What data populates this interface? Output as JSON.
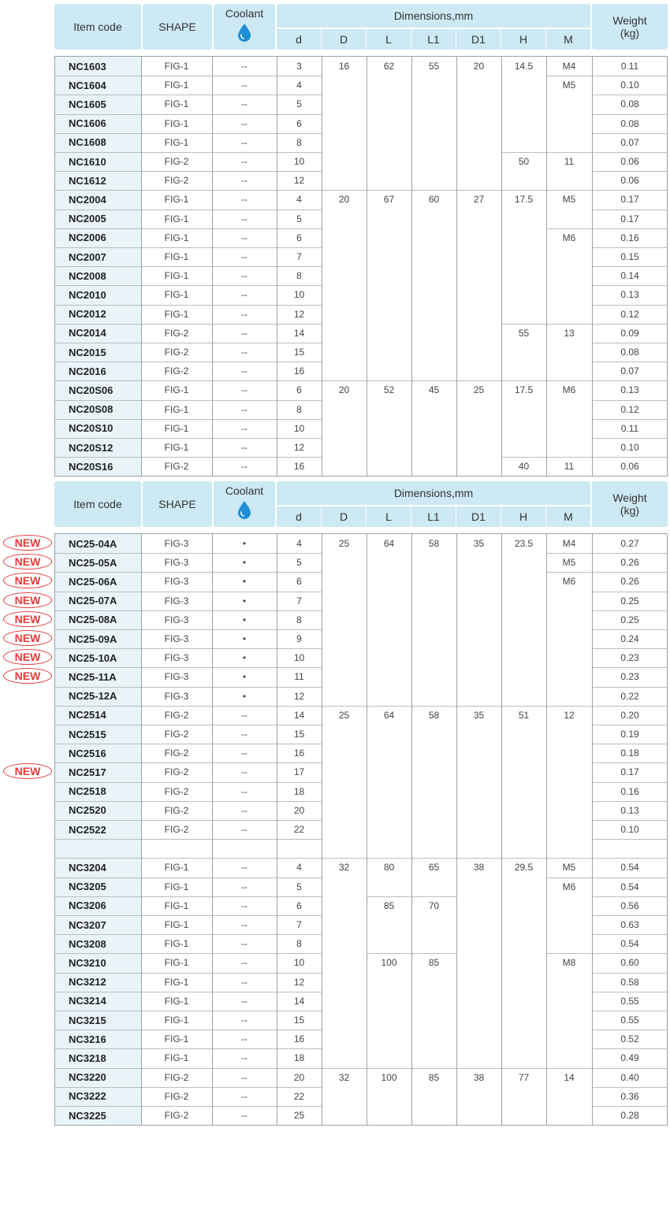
{
  "headers": {
    "item_code": "Item code",
    "shape": "SHAPE",
    "coolant": "Coolant",
    "dimensions": "Dimensions,mm",
    "dim_cols": [
      "d",
      "D",
      "L",
      "L1",
      "D1",
      "H",
      "M"
    ],
    "weight": "Weight\n(kg)"
  },
  "new_label": "NEW",
  "coolant_icon": "water-drop-icon",
  "colors": {
    "header_bg": "#cde9f3",
    "code_bg": "#e9f4f8",
    "new": "#e53a3a",
    "drop": "#1e8fd6"
  },
  "table1": [
    {
      "code": "NC1603",
      "shape": "FIG-1",
      "coolant": "--",
      "d": "3",
      "D": "16",
      "L": "62",
      "L1": "55",
      "D1": "20",
      "H": "14.5",
      "M": "M4",
      "w": "0.11"
    },
    {
      "code": "NC1604",
      "shape": "FIG-1",
      "coolant": "--",
      "d": "4",
      "D": "",
      "L": "",
      "L1": "",
      "D1": "",
      "H": "",
      "M": "M5",
      "w": "0.10"
    },
    {
      "code": "NC1605",
      "shape": "FIG-1",
      "coolant": "--",
      "d": "5",
      "D": "",
      "L": "",
      "L1": "",
      "D1": "",
      "H": "",
      "M": "",
      "w": "0.08"
    },
    {
      "code": "NC1606",
      "shape": "FIG-1",
      "coolant": "--",
      "d": "6",
      "D": "",
      "L": "",
      "L1": "",
      "D1": "",
      "H": "",
      "M": "",
      "w": "0.08"
    },
    {
      "code": "NC1608",
      "shape": "FIG-1",
      "coolant": "--",
      "d": "8",
      "D": "",
      "L": "",
      "L1": "",
      "D1": "",
      "H": "",
      "M": "",
      "w": "0.07"
    },
    {
      "code": "NC1610",
      "shape": "FIG-2",
      "coolant": "--",
      "d": "10",
      "D": "",
      "L": "",
      "L1": "",
      "D1": "",
      "H": "50",
      "M": "11",
      "w": "0.06"
    },
    {
      "code": "NC1612",
      "shape": "FIG-2",
      "coolant": "--",
      "d": "12",
      "D": "",
      "L": "",
      "L1": "",
      "D1": "",
      "H": "",
      "M": "",
      "w": "0.06"
    },
    {
      "code": "NC2004",
      "shape": "FIG-1",
      "coolant": "--",
      "d": "4",
      "D": "20",
      "L": "67",
      "L1": "60",
      "D1": "27",
      "H": "17.5",
      "M": "M5",
      "w": "0.17"
    },
    {
      "code": "NC2005",
      "shape": "FIG-1",
      "coolant": "--",
      "d": "5",
      "D": "",
      "L": "",
      "L1": "",
      "D1": "",
      "H": "",
      "M": "",
      "w": "0.17"
    },
    {
      "code": "NC2006",
      "shape": "FIG-1",
      "coolant": "--",
      "d": "6",
      "D": "",
      "L": "",
      "L1": "",
      "D1": "",
      "H": "",
      "M": "M6",
      "w": "0.16"
    },
    {
      "code": "NC2007",
      "shape": "FIG-1",
      "coolant": "--",
      "d": "7",
      "D": "",
      "L": "",
      "L1": "",
      "D1": "",
      "H": "",
      "M": "",
      "w": "0.15"
    },
    {
      "code": "NC2008",
      "shape": "FIG-1",
      "coolant": "--",
      "d": "8",
      "D": "",
      "L": "",
      "L1": "",
      "D1": "",
      "H": "",
      "M": "",
      "w": "0.14"
    },
    {
      "code": "NC2010",
      "shape": "FIG-1",
      "coolant": "--",
      "d": "10",
      "D": "",
      "L": "",
      "L1": "",
      "D1": "",
      "H": "",
      "M": "",
      "w": "0.13"
    },
    {
      "code": "NC2012",
      "shape": "FIG-1",
      "coolant": "--",
      "d": "12",
      "D": "",
      "L": "",
      "L1": "",
      "D1": "",
      "H": "",
      "M": "",
      "w": "0.12"
    },
    {
      "code": "NC2014",
      "shape": "FIG-2",
      "coolant": "--",
      "d": "14",
      "D": "",
      "L": "",
      "L1": "",
      "D1": "",
      "H": "55",
      "M": "13",
      "w": "0.09"
    },
    {
      "code": "NC2015",
      "shape": "FIG-2",
      "coolant": "--",
      "d": "15",
      "D": "",
      "L": "",
      "L1": "",
      "D1": "",
      "H": "",
      "M": "",
      "w": "0.08"
    },
    {
      "code": "NC2016",
      "shape": "FIG-2",
      "coolant": "--",
      "d": "16",
      "D": "",
      "L": "",
      "L1": "",
      "D1": "",
      "H": "",
      "M": "",
      "w": "0.07"
    },
    {
      "code": "NC20S06",
      "shape": "FIG-1",
      "coolant": "--",
      "d": "6",
      "D": "20",
      "L": "52",
      "L1": "45",
      "D1": "25",
      "H": "17.5",
      "M": "M6",
      "w": "0.13"
    },
    {
      "code": "NC20S08",
      "shape": "FIG-1",
      "coolant": "--",
      "d": "8",
      "D": "",
      "L": "",
      "L1": "",
      "D1": "",
      "H": "",
      "M": "",
      "w": "0.12"
    },
    {
      "code": "NC20S10",
      "shape": "FIG-1",
      "coolant": "--",
      "d": "10",
      "D": "",
      "L": "",
      "L1": "",
      "D1": "",
      "H": "",
      "M": "",
      "w": "0.11"
    },
    {
      "code": "NC20S12",
      "shape": "FIG-1",
      "coolant": "--",
      "d": "12",
      "D": "",
      "L": "",
      "L1": "",
      "D1": "",
      "H": "",
      "M": "",
      "w": "0.10"
    },
    {
      "code": "NC20S16",
      "shape": "FIG-2",
      "coolant": "--",
      "d": "16",
      "D": "",
      "L": "",
      "L1": "",
      "D1": "",
      "H": "40",
      "M": "11",
      "w": "0.06"
    }
  ],
  "table2": [
    {
      "code": "NC25-04A",
      "new": true,
      "shape": "FIG-3",
      "coolant": "•",
      "d": "4",
      "D": "25",
      "L": "64",
      "L1": "58",
      "D1": "35",
      "H": "23.5",
      "M": "M4",
      "w": "0.27"
    },
    {
      "code": "NC25-05A",
      "new": true,
      "shape": "FIG-3",
      "coolant": "•",
      "d": "5",
      "D": "",
      "L": "",
      "L1": "",
      "D1": "",
      "H": "",
      "M": "M5",
      "w": "0.26"
    },
    {
      "code": "NC25-06A",
      "new": true,
      "shape": "FIG-3",
      "coolant": "•",
      "d": "6",
      "D": "",
      "L": "",
      "L1": "",
      "D1": "",
      "H": "",
      "M": "M6",
      "w": "0.26"
    },
    {
      "code": "NC25-07A",
      "new": true,
      "shape": "FIG-3",
      "coolant": "•",
      "d": "7",
      "D": "",
      "L": "",
      "L1": "",
      "D1": "",
      "H": "",
      "M": "",
      "w": "0.25"
    },
    {
      "code": "NC25-08A",
      "new": true,
      "shape": "FIG-3",
      "coolant": "•",
      "d": "8",
      "D": "",
      "L": "",
      "L1": "",
      "D1": "",
      "H": "",
      "M": "",
      "w": "0.25"
    },
    {
      "code": "NC25-09A",
      "new": true,
      "shape": "FIG-3",
      "coolant": "•",
      "d": "9",
      "D": "",
      "L": "",
      "L1": "",
      "D1": "",
      "H": "",
      "M": "",
      "w": "0.24"
    },
    {
      "code": "NC25-10A",
      "new": true,
      "shape": "FIG-3",
      "coolant": "•",
      "d": "10",
      "D": "",
      "L": "",
      "L1": "",
      "D1": "",
      "H": "",
      "M": "",
      "w": "0.23"
    },
    {
      "code": "NC25-11A",
      "new": true,
      "shape": "FIG-3",
      "coolant": "•",
      "d": "11",
      "D": "",
      "L": "",
      "L1": "",
      "D1": "",
      "H": "",
      "M": "",
      "w": "0.23"
    },
    {
      "code": "NC25-12A",
      "new": false,
      "shape": "FIG-3",
      "coolant": "•",
      "d": "12",
      "D": "",
      "L": "",
      "L1": "",
      "D1": "",
      "H": "",
      "M": "",
      "w": "0.22"
    },
    {
      "code": "NC2514",
      "new": false,
      "shape": "FIG-2",
      "coolant": "--",
      "d": "14",
      "D": "25",
      "L": "64",
      "L1": "58",
      "D1": "35",
      "H": "51",
      "M": "12",
      "w": "0.20"
    },
    {
      "code": "NC2515",
      "new": false,
      "shape": "FIG-2",
      "coolant": "--",
      "d": "15",
      "D": "",
      "L": "",
      "L1": "",
      "D1": "",
      "H": "",
      "M": "",
      "w": "0.19"
    },
    {
      "code": "NC2516",
      "new": false,
      "shape": "FIG-2",
      "coolant": "--",
      "d": "16",
      "D": "",
      "L": "",
      "L1": "",
      "D1": "",
      "H": "",
      "M": "",
      "w": "0.18"
    },
    {
      "code": "NC2517",
      "new": true,
      "shape": "FIG-2",
      "coolant": "--",
      "d": "17",
      "D": "",
      "L": "",
      "L1": "",
      "D1": "",
      "H": "",
      "M": "",
      "w": "0.17"
    },
    {
      "code": "NC2518",
      "new": false,
      "shape": "FIG-2",
      "coolant": "--",
      "d": "18",
      "D": "",
      "L": "",
      "L1": "",
      "D1": "",
      "H": "",
      "M": "",
      "w": "0.16"
    },
    {
      "code": "NC2520",
      "new": false,
      "shape": "FIG-2",
      "coolant": "--",
      "d": "20",
      "D": "",
      "L": "",
      "L1": "",
      "D1": "",
      "H": "",
      "M": "",
      "w": "0.13"
    },
    {
      "code": "NC2522",
      "new": false,
      "shape": "FIG-2",
      "coolant": "--",
      "d": "22",
      "D": "",
      "L": "",
      "L1": "",
      "D1": "",
      "H": "",
      "M": "",
      "w": "0.10"
    },
    {
      "code": "",
      "new": false,
      "shape": "",
      "coolant": "",
      "d": "",
      "D": "",
      "L": "",
      "L1": "",
      "D1": "",
      "H": "",
      "M": "",
      "w": ""
    },
    {
      "code": "NC3204",
      "new": false,
      "shape": "FIG-1",
      "coolant": "--",
      "d": "4",
      "D": "32",
      "L": "80",
      "L1": "65",
      "D1": "38",
      "H": "29.5",
      "M": "M5",
      "w": "0.54"
    },
    {
      "code": "NC3205",
      "new": false,
      "shape": "FIG-1",
      "coolant": "--",
      "d": "5",
      "D": "",
      "L": "",
      "L1": "",
      "D1": "",
      "H": "",
      "M": "M6",
      "w": "0.54"
    },
    {
      "code": "NC3206",
      "new": false,
      "shape": "FIG-1",
      "coolant": "--",
      "d": "6",
      "D": "",
      "L": "85",
      "L1": "70",
      "D1": "",
      "H": "",
      "M": "",
      "w": "0.56"
    },
    {
      "code": "NC3207",
      "new": false,
      "shape": "FIG-1",
      "coolant": "--",
      "d": "7",
      "D": "",
      "L": "",
      "L1": "",
      "D1": "",
      "H": "",
      "M": "",
      "w": "0.63"
    },
    {
      "code": "NC3208",
      "new": false,
      "shape": "FIG-1",
      "coolant": "--",
      "d": "8",
      "D": "",
      "L": "",
      "L1": "",
      "D1": "",
      "H": "",
      "M": "",
      "w": "0.54"
    },
    {
      "code": "NC3210",
      "new": false,
      "shape": "FIG-1",
      "coolant": "--",
      "d": "10",
      "D": "",
      "L": "100",
      "L1": "85",
      "D1": "",
      "H": "",
      "M": "M8",
      "w": "0.60"
    },
    {
      "code": "NC3212",
      "new": false,
      "shape": "FIG-1",
      "coolant": "--",
      "d": "12",
      "D": "",
      "L": "",
      "L1": "",
      "D1": "",
      "H": "",
      "M": "",
      "w": "0.58"
    },
    {
      "code": "NC3214",
      "new": false,
      "shape": "FIG-1",
      "coolant": "--",
      "d": "14",
      "D": "",
      "L": "",
      "L1": "",
      "D1": "",
      "H": "",
      "M": "",
      "w": "0.55"
    },
    {
      "code": "NC3215",
      "new": false,
      "shape": "FIG-1",
      "coolant": "--",
      "d": "15",
      "D": "",
      "L": "",
      "L1": "",
      "D1": "",
      "H": "",
      "M": "",
      "w": "0.55"
    },
    {
      "code": "NC3216",
      "new": false,
      "shape": "FIG-1",
      "coolant": "--",
      "d": "16",
      "D": "",
      "L": "",
      "L1": "",
      "D1": "",
      "H": "",
      "M": "",
      "w": "0.52"
    },
    {
      "code": "NC3218",
      "new": false,
      "shape": "FIG-1",
      "coolant": "--",
      "d": "18",
      "D": "",
      "L": "",
      "L1": "",
      "D1": "",
      "H": "",
      "M": "",
      "w": "0.49"
    },
    {
      "code": "NC3220",
      "new": false,
      "shape": "FIG-2",
      "coolant": "--",
      "d": "20",
      "D": "32",
      "L": "100",
      "L1": "85",
      "D1": "38",
      "H": "77",
      "M": "14",
      "w": "0.40"
    },
    {
      "code": "NC3222",
      "new": false,
      "shape": "FIG-2",
      "coolant": "--",
      "d": "22",
      "D": "",
      "L": "",
      "L1": "",
      "D1": "",
      "H": "",
      "M": "",
      "w": "0.36"
    },
    {
      "code": "NC3225",
      "new": false,
      "shape": "FIG-2",
      "coolant": "--",
      "d": "25",
      "D": "",
      "L": "",
      "L1": "",
      "D1": "",
      "H": "",
      "M": "",
      "w": "0.28"
    }
  ]
}
